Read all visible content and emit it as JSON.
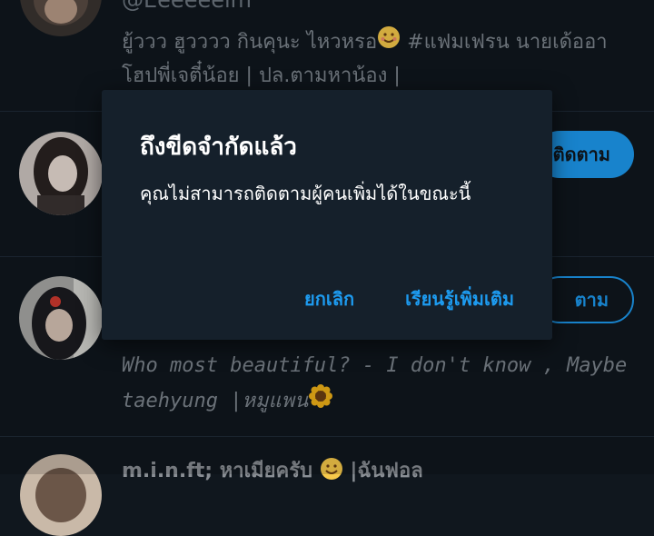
{
  "list": {
    "rows": [
      {
        "handle": "@Eeeeeeim",
        "bio_line1": "ยู้ววว ฮูวววว กินคุนะ ไหวหรอ",
        "bio_line1_suffix": " #แฟมเฟรน นายเด้ออา",
        "bio_line2": "โฮปพี่เจตี๋น้อย | ปล.ตามหาน้อง |"
      },
      {
        "follow_label": "ติดตาม"
      },
      {
        "follow_label": "ตาม",
        "bio_line1": "Who most beautiful? - I don't know , Maybe",
        "bio_line2": "taehyung |หมูแพน"
      },
      {
        "handle": "m.i.n.ft; หาเมียครับ",
        "handle_suffix": " |ฉันฟอล"
      }
    ]
  },
  "dialog": {
    "title": "ถึงขีดจำกัดแล้ว",
    "message": "คุณไม่สามารถติดตามผู้คนเพิ่มได้ในขณะนี้",
    "cancel_label": "ยกเลิก",
    "learn_more_label": "เรียนรู้เพิ่มเติม"
  },
  "colors": {
    "background": "#10171e",
    "dialog_background": "#15202b",
    "accent": "#1d9bf0",
    "text_primary": "#ffffff",
    "text_secondary": "#7d858d"
  },
  "icons": [
    "smiling-face-emoji",
    "sunflower-emoji"
  ]
}
